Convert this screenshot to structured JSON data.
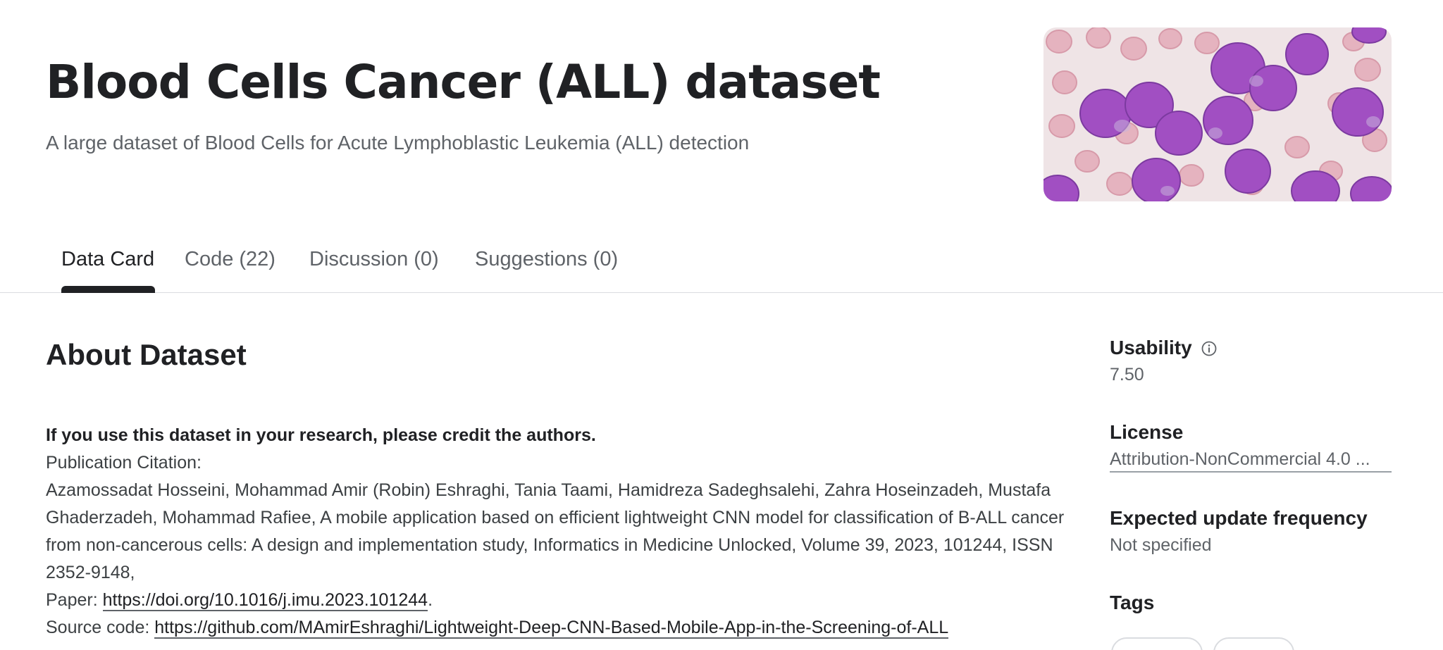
{
  "header": {
    "title": "Blood Cells Cancer (ALL) dataset",
    "subtitle": "A large dataset of Blood Cells for Acute Lymphoblastic Leukemia (ALL) detection"
  },
  "tabs": [
    {
      "label": "Data Card",
      "active": true
    },
    {
      "label": "Code (22)",
      "active": false
    },
    {
      "label": "Discussion (0)",
      "active": false
    },
    {
      "label": "Suggestions (0)",
      "active": false
    }
  ],
  "about": {
    "heading": "About Dataset",
    "credit_note": "If you use this dataset in your research, please credit the authors.",
    "citation_label": "Publication Citation:",
    "citation_text": "Azamossadat Hosseini, Mohammad Amir (Robin) Eshraghi, Tania Taami, Hamidreza Sadeghsalehi, Zahra Hoseinzadeh, Mustafa Ghaderzadeh, Mohammad Rafiee, A mobile application based on efficient lightweight CNN model for classification of B-ALL cancer from non-cancerous cells: A design and implementation study, Informatics in Medicine Unlocked, Volume 39, 2023, 101244, ISSN 2352-9148,",
    "paper_label": "Paper: ",
    "paper_url": "https://doi.org/10.1016/j.imu.2023.101244",
    "paper_suffix": ".",
    "source_label": "Source code: ",
    "source_url": "https://github.com/MAmirEshraghi/Lightweight-Deep-CNN-Based-Mobile-App-in-the-Screening-of-ALL"
  },
  "sidebar": {
    "usability_label": "Usability",
    "usability_value": "7.50",
    "license_label": "License",
    "license_value": "Attribution-NonCommercial 4.0 ...",
    "frequency_label": "Expected update frequency",
    "frequency_value": "Not specified",
    "tags_label": "Tags"
  },
  "icons": {
    "info": "info-icon",
    "hero": "blood-cells-image"
  },
  "colors": {
    "text_primary": "#202124",
    "text_secondary": "#5f6368",
    "cell_purple": "#a24fc0",
    "rbc_pink": "#e7b9c3"
  }
}
